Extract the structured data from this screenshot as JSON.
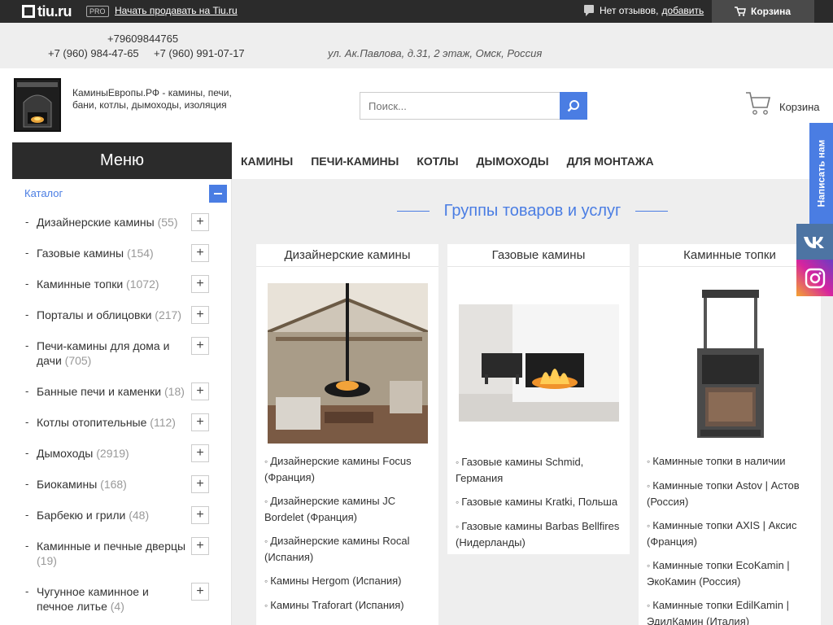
{
  "topbar": {
    "logo": "tiu.ru",
    "pro": "PRO",
    "sell_link": "Начать продавать на Tiu.ru",
    "reviews_text": "Нет отзывов,",
    "reviews_add": "добавить",
    "cart_label": "Корзина"
  },
  "contacts": {
    "phone1": "+79609844765",
    "phone2": "+7 (960) 984-47-65",
    "phone3": "+7 (960) 991-07-17",
    "address": "ул. Ак.Павлова, д.31, 2 этаж, Омск, Россия"
  },
  "header": {
    "site_desc": "КаминыЕвропы.РФ - камины, печи, бани, котлы, дымоходы, изоляция",
    "search_placeholder": "Поиск...",
    "cart_label": "Корзина"
  },
  "menu": {
    "title": "Меню",
    "catalog": "Каталог",
    "items": [
      {
        "label": "Дизайнерские камины",
        "count": "(55)"
      },
      {
        "label": "Газовые камины",
        "count": "(154)"
      },
      {
        "label": "Каминные топки",
        "count": "(1072)"
      },
      {
        "label": "Порталы и облицовки",
        "count": "(217)"
      },
      {
        "label": "Печи-камины для дома и дачи",
        "count": "(705)"
      },
      {
        "label": "Банные печи и каменки",
        "count": "(18)"
      },
      {
        "label": "Котлы отопительные",
        "count": "(112)"
      },
      {
        "label": "Дымоходы",
        "count": "(2919)"
      },
      {
        "label": "Биокамины",
        "count": "(168)"
      },
      {
        "label": "Барбекю и грили",
        "count": "(48)"
      },
      {
        "label": "Каминные и печные дверцы",
        "count": "(19)"
      },
      {
        "label": "Чугунное каминное и печное литье",
        "count": "(4)"
      }
    ]
  },
  "nav": [
    "КАМИНЫ",
    "ПЕЧИ-КАМИНЫ",
    "КОТЛЫ",
    "ДЫМОХОДЫ",
    "ДЛЯ МОНТАЖА"
  ],
  "content": {
    "groups_title": "Группы товаров и услуг",
    "cards": [
      {
        "title": "Дизайнерские камины",
        "links": [
          "Дизайнерские камины Focus (Франция)",
          "Дизайнерские камины JC Bordelet (Франция)",
          "Дизайнерские камины Rocal (Испания)",
          "Камины Hergom (Испания)",
          "Камины Traforart (Испания)"
        ]
      },
      {
        "title": "Газовые камины",
        "links": [
          "Газовые камины Schmid, Германия",
          "Газовые камины Kratki, Польша",
          "Газовые камины Barbas Bellfires (Нидерланды)"
        ]
      },
      {
        "title": "Каминные топки",
        "links": [
          "Каминные топки в наличии",
          "Каминные топки Astov | Астов (Россия)",
          "Каминные топки AXIS | Аксис (Франция)",
          "Каминные топки EcoKamin | ЭкоКамин (Россия)",
          "Каминные топки EdilKamin | ЭдилКамин (Италия)"
        ]
      }
    ]
  },
  "side": {
    "write_us": "Написать нам"
  }
}
